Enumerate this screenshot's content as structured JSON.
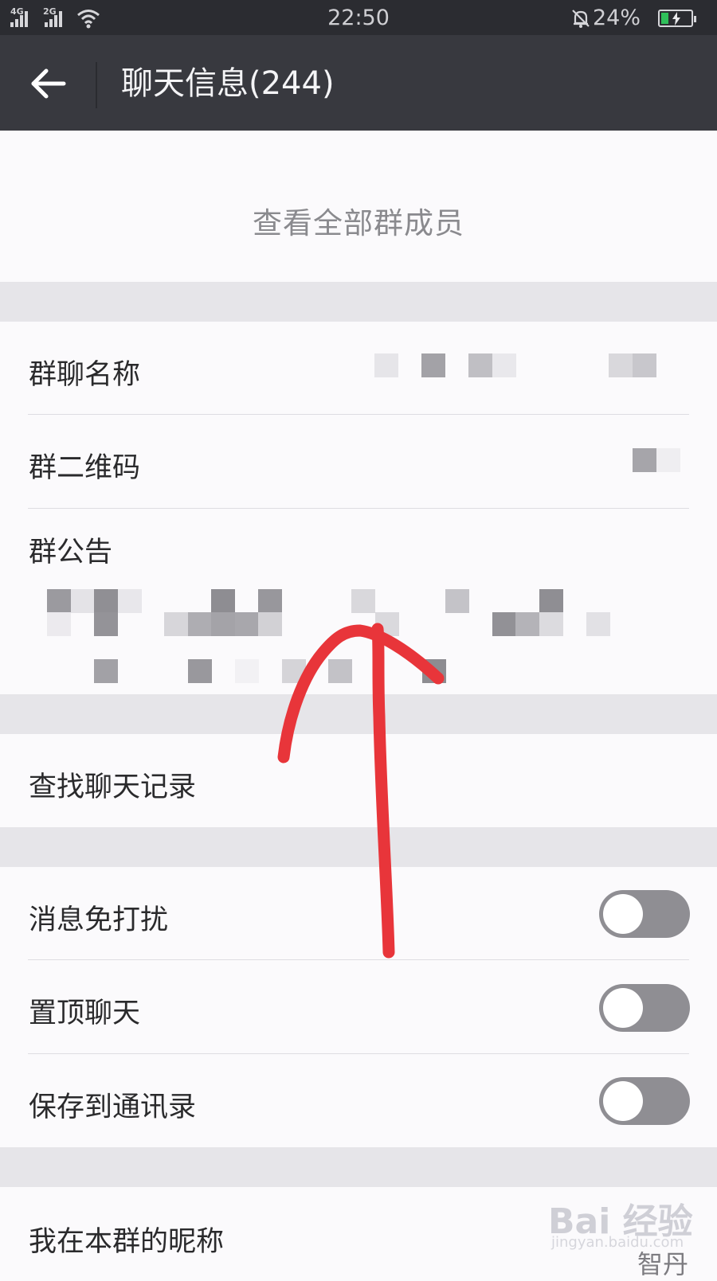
{
  "status_bar": {
    "signal_1": "4G",
    "signal_2": "2G",
    "time": "22:50",
    "battery_percent": "24%",
    "icons": [
      "signal-4g-icon",
      "signal-2g-icon",
      "wifi-icon",
      "bell-muted-icon",
      "battery-charging-icon"
    ]
  },
  "toolbar": {
    "back_icon": "arrow-left-icon",
    "title": "聊天信息(244)"
  },
  "members": {
    "view_all_label": "查看全部群成员"
  },
  "group_info": {
    "name_label": "群聊名称",
    "qr_label": "群二维码",
    "notice_label": "群公告"
  },
  "search": {
    "label": "查找聊天记录"
  },
  "settings": {
    "items": [
      {
        "label": "消息免打扰",
        "enabled": false
      },
      {
        "label": "置顶聊天",
        "enabled": false
      },
      {
        "label": "保存到通讯录",
        "enabled": false
      }
    ]
  },
  "nickname": {
    "label": "我在本群的昵称",
    "value": "智丹"
  },
  "watermark": {
    "brand": "Bai 经验",
    "url": "jingyan.baidu.com"
  },
  "colors": {
    "annotation_arrow": "#e8353a",
    "toolbar_bg": "#38393f",
    "toggle_off": "#8f8e93"
  }
}
